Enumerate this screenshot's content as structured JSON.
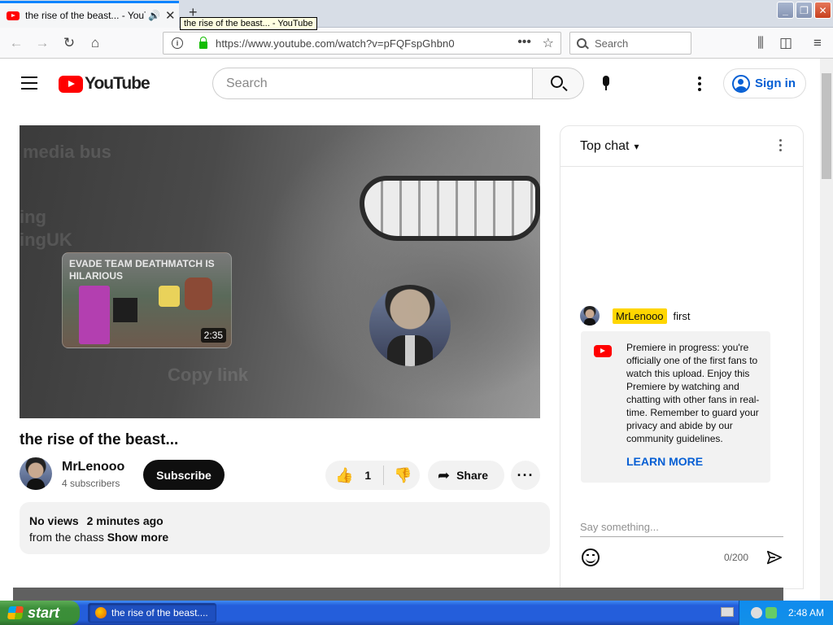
{
  "browser": {
    "tab_title": "the rise of the beast... - YouTube",
    "tooltip": "the rise of the beast... - YouTube",
    "url": "https://www.youtube.com/watch?v=pFQFspGhbn0",
    "search_placeholder": "Search",
    "window_controls": [
      "minimize",
      "restore",
      "close"
    ]
  },
  "header": {
    "logo_text": "YouTube",
    "search_placeholder": "Search",
    "signin_label": "Sign in"
  },
  "player": {
    "ghost_text_1": "media bus",
    "ghost_text_2": "ing",
    "ghost_text_3": "ingUK",
    "ghost_text_4": "Copy link",
    "endcard_title": "EVADE TEAM DEATHMATCH IS HILARIOUS",
    "endcard_duration": "2:35"
  },
  "video": {
    "title": "the rise of the beast...",
    "channel_name": "MrLenooo",
    "subscribers": "4 subscribers",
    "subscribe_label": "Subscribe",
    "like_count": "1",
    "share_label": "Share",
    "views": "No views",
    "age": "2 minutes ago",
    "description": "from the chass",
    "show_more": "Show more"
  },
  "chat": {
    "mode_label": "Top chat",
    "message": {
      "author": "MrLenooo",
      "text": "first"
    },
    "notice_text": "Premiere in progress: you're officially one of the first fans to watch this upload. Enjoy this Premiere by watching and chatting with other fans in real-time. Remember to guard your privacy and abide by our community guidelines.",
    "learn_more": "LEARN MORE",
    "input_placeholder": "Say something...",
    "char_counter": "0/200"
  },
  "taskbar": {
    "start_label": "start",
    "task_item": "the rise of the beast....",
    "clock": "2:48 AM"
  },
  "colors": {
    "youtube_red": "#ff0000",
    "link_blue": "#065fd4",
    "author_highlight": "#ffd600",
    "xp_taskbar": "#245edb",
    "xp_start": "#3c8f3a"
  }
}
